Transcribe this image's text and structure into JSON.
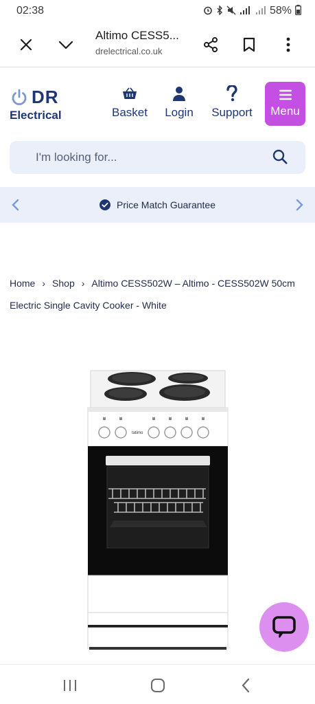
{
  "status_bar": {
    "time": "02:38",
    "battery": "58%"
  },
  "browser": {
    "tab_title": "Altimo CESS5...",
    "domain": "drelectrical.co.uk"
  },
  "site": {
    "logo": {
      "brand_top": "DR",
      "brand_bottom": "Electrical"
    },
    "nav": {
      "basket": "Basket",
      "login": "Login",
      "support": "Support",
      "menu": "Menu"
    },
    "brand_color": "#1e3772",
    "accent_color": "#c34fe3"
  },
  "search": {
    "placeholder": "I'm looking for..."
  },
  "promo": {
    "text": "Price Match Guarantee"
  },
  "breadcrumb": {
    "home": "Home",
    "shop": "Shop",
    "current": "Altimo CESS502W – Altimo - CESS502W 50cm Electric Single Cavity Cooker - White"
  },
  "product": {
    "cooker_brand_label": "tatimo"
  }
}
